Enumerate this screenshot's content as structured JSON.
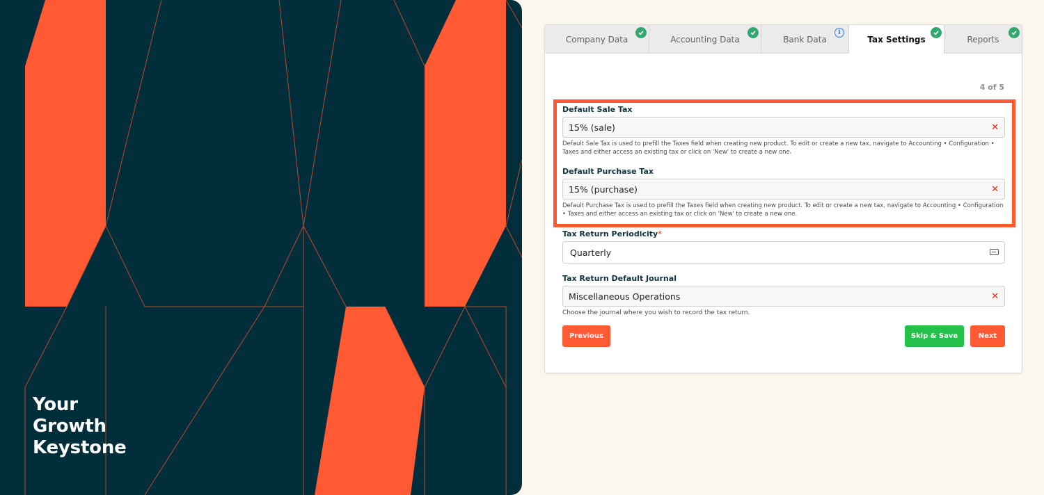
{
  "hero": {
    "tagline": [
      "Your",
      "Growth",
      "Keystone"
    ],
    "colors": {
      "background": "#022d3a",
      "accent": "#ff5a33"
    }
  },
  "wizard": {
    "tabs": [
      {
        "label": "Company Data",
        "status_icon": "check-circle-icon"
      },
      {
        "label": "Accounting Data",
        "status_icon": "check-circle-icon"
      },
      {
        "label": "Bank Data",
        "status_icon": "info-circle-icon"
      },
      {
        "label": "Tax Settings",
        "status_icon": "check-circle-icon",
        "active": true
      },
      {
        "label": "Reports",
        "status_icon": "check-circle-icon"
      }
    ],
    "step": "4 of 5",
    "fields": {
      "default_sale_tax": {
        "label": "Default Sale Tax",
        "value": "15% (sale)",
        "help": "Default Sale Tax is used to prefill the Taxes field when creating new product. To edit or create a new tax, navigate to Accounting • Configuration • Taxes and either access an existing tax or click on 'New' to create a new one."
      },
      "default_purchase_tax": {
        "label": "Default Purchase Tax",
        "value": "15% (purchase)",
        "help": "Default Purchase Tax is used to prefill the Taxes field when creating new product. To edit or create a new tax, navigate to Accounting • Configuration • Taxes and either access an existing tax or click on 'New' to create a new one."
      },
      "tax_return_periodicity": {
        "label": "Tax Return Periodicity",
        "required_mark": "*",
        "value": "Quarterly"
      },
      "tax_return_default_journal": {
        "label": "Tax Return Default Journal",
        "value": "Miscellaneous Operations",
        "help": "Choose the journal where you wish to record the tax return."
      }
    },
    "buttons": {
      "previous": "Previous",
      "skip_save": "Skip & Save",
      "next": "Next"
    },
    "colors": {
      "primary": "#ff5a33",
      "success": "#23c04a",
      "badge_check": "#34a770",
      "info": "#2f7fdb",
      "highlight": "#ff5a33"
    }
  }
}
